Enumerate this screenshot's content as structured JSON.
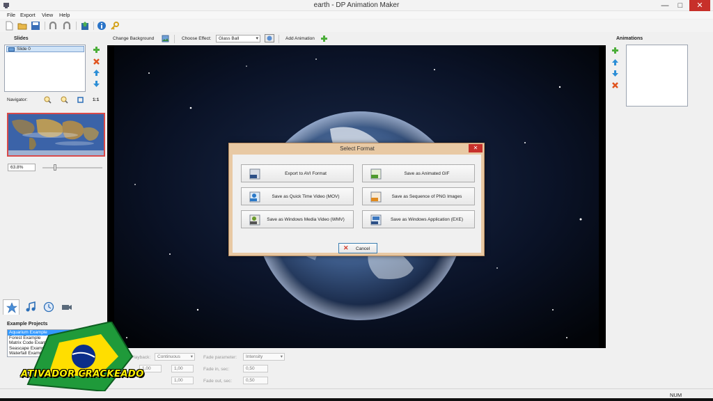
{
  "window": {
    "title": "earth - DP Animation Maker",
    "min": "—",
    "max": "□",
    "close": "✕"
  },
  "menu": [
    "File",
    "Export",
    "View",
    "Help"
  ],
  "toolbar_icons": [
    "new-icon",
    "open-icon",
    "save-icon",
    "undo-icon",
    "redo-icon",
    "export-icon",
    "info-icon",
    "key-icon"
  ],
  "effect_bar": {
    "change_background": "Change Background",
    "choose_effect_label": "Choose Effect:",
    "effect_value": "Glass Ball",
    "add_animation": "Add Animation"
  },
  "slides": {
    "title": "Slides",
    "items": [
      "Slide 0"
    ]
  },
  "navigator": {
    "label": "Navigator:",
    "one_to_one": "1:1",
    "zoom": "63.8%"
  },
  "example_projects": {
    "title": "Example Projects",
    "items": [
      "Aquarium Example",
      "Forest Example",
      "Matrix Code Example",
      "Seascape Example",
      "Waterfall Example"
    ],
    "selected_index": 0
  },
  "animations": {
    "title": "Animations"
  },
  "bottom_controls": {
    "playback_label": "Playback:",
    "playback_value": "Continuous",
    "fade_parameter_label": "Fade parameter:",
    "fade_parameter_value": "Intensity",
    "fade_in_label": "Fade in, sec:",
    "fade_in_value": "0,50",
    "fade_out_label": "Fade out, sec:",
    "fade_out_value": "0,50",
    "val1": "1,00",
    "val2": "1,00",
    "val3": "1,00"
  },
  "dialog": {
    "title": "Select Format",
    "buttons": [
      {
        "label": "Export to AVI Format",
        "badge": "AVI"
      },
      {
        "label": "Save as Animated GIF",
        "badge": "GIF"
      },
      {
        "label": "Save as Quick Time Video (MOV)",
        "badge": "MOV"
      },
      {
        "label": "Save as Sequence of PNG Images",
        "badge": "PNG"
      },
      {
        "label": "Save as Windows Media Video (WMV)",
        "badge": "WMV"
      },
      {
        "label": "Save as Windows Application (EXE)",
        "badge": "EXE"
      }
    ],
    "cancel": "Cancel"
  },
  "status": {
    "num": "NUM"
  },
  "watermark": {
    "text": "ATIVADOR CRACKEADO"
  }
}
